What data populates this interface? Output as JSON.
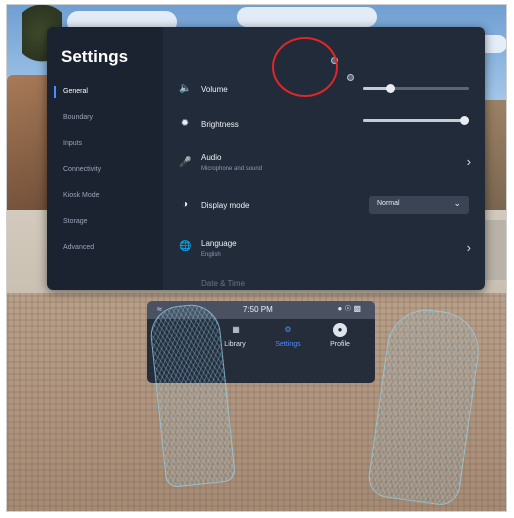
{
  "settings": {
    "title": "Settings",
    "nav": [
      {
        "label": "General",
        "active": true
      },
      {
        "label": "Boundary",
        "active": false
      },
      {
        "label": "Inputs",
        "active": false
      },
      {
        "label": "Connectivity",
        "active": false
      },
      {
        "label": "Kiosk Mode",
        "active": false
      },
      {
        "label": "Storage",
        "active": false
      },
      {
        "label": "Advanced",
        "active": false
      }
    ],
    "volume": {
      "label": "Volume",
      "level": 0.25
    },
    "brightness": {
      "label": "Brightness",
      "level": 1.0
    },
    "audio": {
      "label": "Audio",
      "sub": "Microphone and sound"
    },
    "display_mode": {
      "label": "Display mode",
      "value": "Normal"
    },
    "language": {
      "label": "Language",
      "sub": "English"
    },
    "date_time": {
      "label": "Date & Time"
    }
  },
  "taskbar": {
    "time": "7:50 PM",
    "items": [
      {
        "label": "Library",
        "icon": "grid-icon",
        "active": false
      },
      {
        "label": "Settings",
        "icon": "gear-icon",
        "active": true
      },
      {
        "label": "Profile",
        "icon": "person-icon",
        "active": false
      }
    ]
  },
  "colors": {
    "accent": "#4a8cff",
    "panel_bg": "#222b3a",
    "sidebar_bg": "#1b2230",
    "highlight_circle": "#e02626"
  }
}
